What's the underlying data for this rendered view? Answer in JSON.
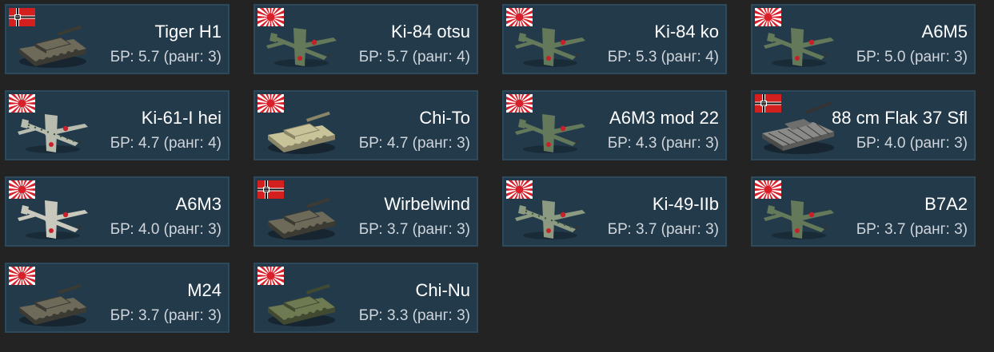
{
  "vehicles": [
    {
      "name": "Tiger H1",
      "br": "БР: 5.7 (ранг: 3)",
      "flag": "germany-flag-icon",
      "kind": "tank",
      "icon": "tiger-h1-tank-icon"
    },
    {
      "name": "Ki-84 otsu",
      "br": "БР: 5.7 (ранг: 4)",
      "flag": "japan-flag-icon",
      "kind": "plane",
      "icon": "ki-84-otsu-plane-icon"
    },
    {
      "name": "Ki-84 ko",
      "br": "БР: 5.3 (ранг: 4)",
      "flag": "japan-flag-icon",
      "kind": "plane",
      "icon": "ki-84-ko-plane-icon"
    },
    {
      "name": "A6M5",
      "br": "БР: 5.0 (ранг: 3)",
      "flag": "japan-flag-icon",
      "kind": "plane",
      "icon": "a6m5-plane-icon"
    },
    {
      "name": "Ki-61-I hei",
      "br": "БР: 4.7 (ранг: 4)",
      "flag": "japan-flag-icon",
      "kind": "plane-spotted",
      "icon": "ki-61-i-hei-plane-icon"
    },
    {
      "name": "Chi-To",
      "br": "БР: 4.7 (ранг: 3)",
      "flag": "japan-flag-icon",
      "kind": "tank-light",
      "icon": "chi-to-tank-icon"
    },
    {
      "name": "A6M3 mod 22",
      "br": "БР: 4.3 (ранг: 3)",
      "flag": "japan-flag-icon",
      "kind": "plane",
      "icon": "a6m3-mod-22-plane-icon"
    },
    {
      "name": "88 cm Flak 37 Sfl",
      "br": "БР: 4.0 (ранг: 3)",
      "flag": "germany-flag-icon",
      "kind": "spaa",
      "icon": "flak-37-sfl-icon"
    },
    {
      "name": "A6M3",
      "br": "БР: 4.0 (ранг: 3)",
      "flag": "japan-flag-icon",
      "kind": "plane-light",
      "icon": "a6m3-plane-icon"
    },
    {
      "name": "Wirbelwind",
      "br": "БР: 3.7 (ранг: 3)",
      "flag": "germany-flag-icon",
      "kind": "tank",
      "icon": "wirbelwind-tank-icon"
    },
    {
      "name": "Ki-49-IIb",
      "br": "БР: 3.7 (ранг: 3)",
      "flag": "japan-flag-icon",
      "kind": "bomber",
      "icon": "ki-49-iib-bomber-icon"
    },
    {
      "name": "B7A2",
      "br": "БР: 3.7 (ранг: 3)",
      "flag": "japan-flag-icon",
      "kind": "plane",
      "icon": "b7a2-plane-icon"
    },
    {
      "name": "M24",
      "br": "БР: 3.7 (ранг: 3)",
      "flag": "japan-flag-icon",
      "kind": "tank",
      "icon": "m24-tank-icon"
    },
    {
      "name": "Chi-Nu",
      "br": "БР: 3.3 (ранг: 3)",
      "flag": "japan-flag-icon",
      "kind": "tank-green",
      "icon": "chi-nu-tank-icon"
    }
  ],
  "colors": {
    "page_bg": "#232324",
    "card_bg": "#233a4b",
    "card_border": "#2d4a5d",
    "name_text": "#ffffff",
    "br_text": "#cfd5da"
  }
}
